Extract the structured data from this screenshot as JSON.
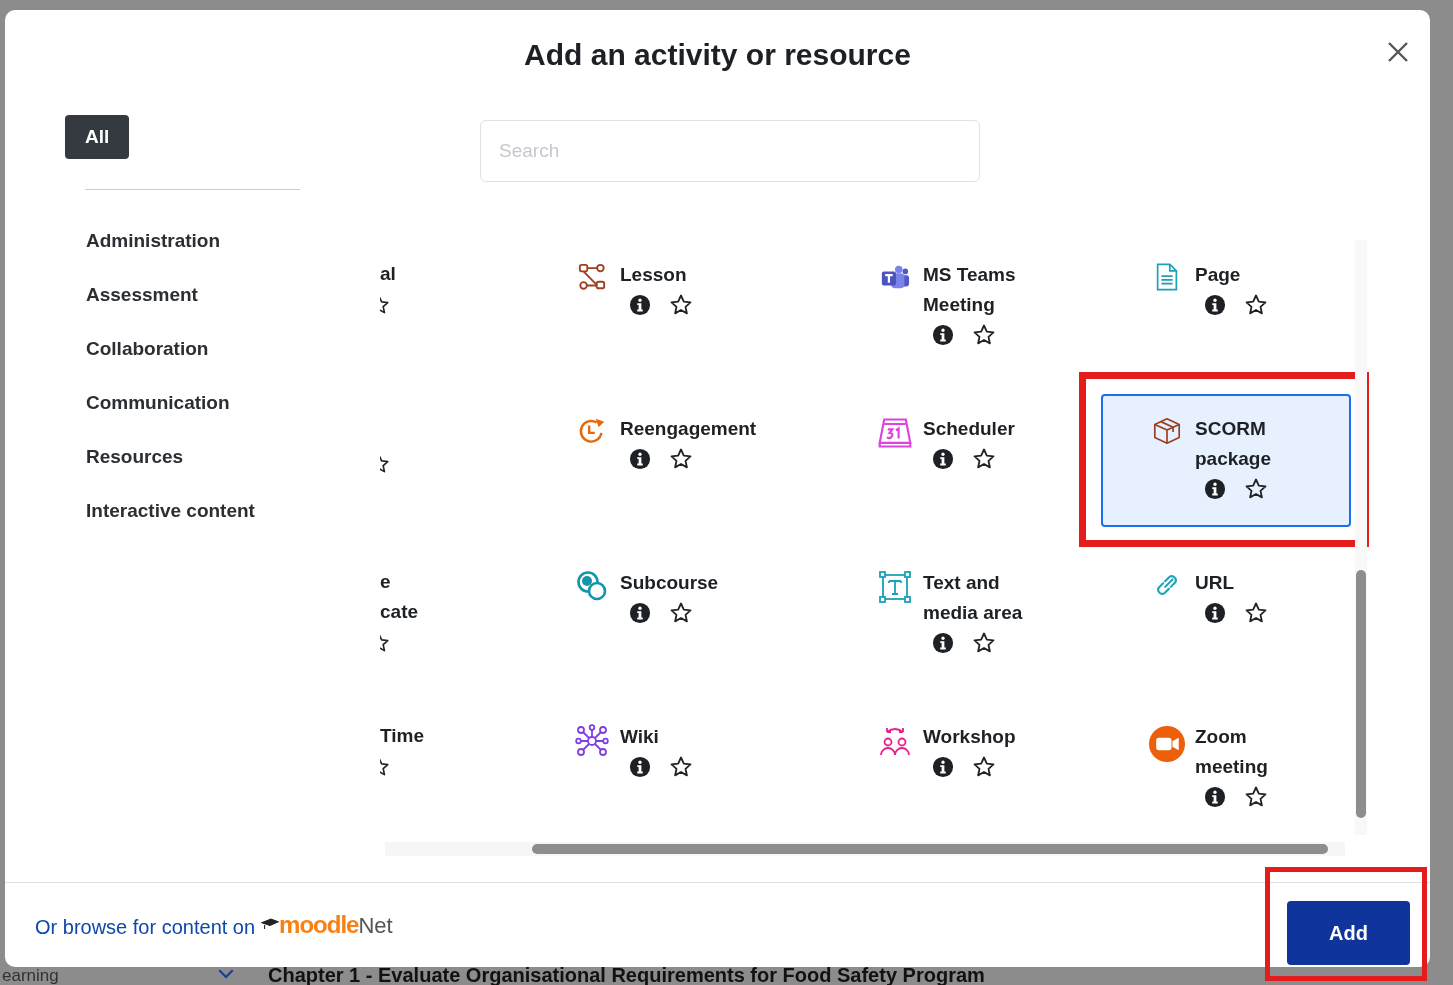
{
  "background": {
    "chapter_heading": "Chapter 1 - Evaluate Organisational Requirements for Food Safety Program",
    "left_fragment": "earning"
  },
  "dialog": {
    "title": "Add an activity or resource",
    "tabs": [
      {
        "label": "All",
        "selected": true
      }
    ],
    "categories": [
      {
        "label": "Administration",
        "selected": false
      },
      {
        "label": "Assessment",
        "selected": false
      },
      {
        "label": "Collaboration",
        "selected": false
      },
      {
        "label": "Communication",
        "selected": false
      },
      {
        "label": "Resources",
        "selected": false
      },
      {
        "label": "Interactive content",
        "selected": false
      }
    ],
    "search": {
      "placeholder": "Search"
    },
    "items": [
      {
        "kind": "cut",
        "name_lines": [
          "al"
        ]
      },
      {
        "kind": "activity",
        "name": "Lesson",
        "selected": false,
        "highlighted": false
      },
      {
        "kind": "activity",
        "name": "MS Teams Meeting",
        "selected": false,
        "highlighted": false
      },
      {
        "kind": "activity",
        "name": "Page",
        "selected": false,
        "highlighted": false
      },
      {
        "kind": "cut"
      },
      {
        "kind": "activity",
        "name": "Reengagement",
        "selected": false,
        "highlighted": false
      },
      {
        "kind": "activity",
        "name": "Scheduler",
        "selected": false,
        "highlighted": false
      },
      {
        "kind": "activity",
        "name": "SCORM package",
        "selected": true,
        "highlighted": true
      },
      {
        "kind": "cut",
        "name_lines": [
          "e",
          "cate"
        ]
      },
      {
        "kind": "activity",
        "name": "Subcourse",
        "selected": false,
        "highlighted": false
      },
      {
        "kind": "activity",
        "name": "Text and media area",
        "selected": false,
        "highlighted": false
      },
      {
        "kind": "activity",
        "name": "URL",
        "selected": false,
        "highlighted": false
      },
      {
        "kind": "cut",
        "name_lines": [
          "Time"
        ]
      },
      {
        "kind": "activity",
        "name": "Wiki",
        "selected": false,
        "highlighted": false
      },
      {
        "kind": "activity",
        "name": "Workshop",
        "selected": false,
        "highlighted": false
      },
      {
        "kind": "activity",
        "name": "Zoom meeting",
        "selected": false,
        "highlighted": false
      }
    ],
    "footer": {
      "link_text": "Or browse for content on",
      "logo_part_1": "moodle",
      "logo_part_2": "Net",
      "add_button": {
        "label": "Add",
        "highlighted": true
      }
    }
  }
}
